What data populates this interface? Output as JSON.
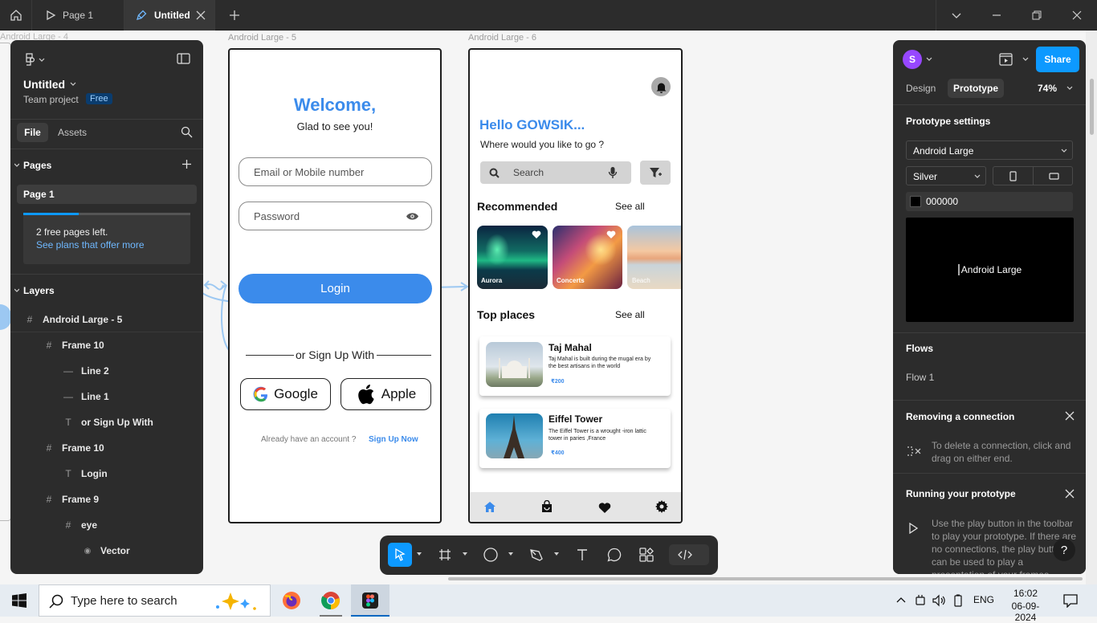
{
  "titlebar": {
    "tabs": [
      {
        "label": "Page 1"
      },
      {
        "label": "Untitled"
      }
    ]
  },
  "canvas": {
    "frame_labels": [
      "Android Large - 4",
      "Android Large - 5",
      "Android Large - 6"
    ]
  },
  "left_panel": {
    "file_name": "Untitled",
    "project": "Team project",
    "plan_badge": "Free",
    "tabs": {
      "file": "File",
      "assets": "Assets"
    },
    "pages_header": "Pages",
    "page_item": "Page 1",
    "free_pages_text": "2 free pages left.",
    "free_pages_fill": 0.33,
    "plans_link": "See plans that offer more",
    "layers_header": "Layers",
    "layers": [
      {
        "label": "Android Large - 5",
        "icon": "frame-icon"
      },
      {
        "label": "Frame 10",
        "icon": "frame-icon"
      },
      {
        "label": "Line 2",
        "icon": "line-icon"
      },
      {
        "label": "Line 1",
        "icon": "line-icon"
      },
      {
        "label": "or Sign Up With",
        "icon": "text-icon"
      },
      {
        "label": "Frame 10",
        "icon": "frame-icon"
      },
      {
        "label": "Login",
        "icon": "text-icon"
      },
      {
        "label": "Frame 9",
        "icon": "frame-icon"
      },
      {
        "label": "eye",
        "icon": "frame-icon"
      },
      {
        "label": "Vector",
        "icon": "vector-icon"
      }
    ]
  },
  "login_screen": {
    "welcome": "Welcome,",
    "subtitle": "Glad to see you!",
    "email_placeholder": "Email or Mobile number",
    "password_placeholder": "Password",
    "login_button": "Login",
    "divider_text": "or Sign Up With",
    "google": "Google",
    "apple": "Apple",
    "account_prompt": "Already have an account ?",
    "signup_link": "Sign Up Now"
  },
  "home_screen": {
    "greeting": "Hello GOWSIK...",
    "question": "Where would you like to go ?",
    "search_placeholder": "Search",
    "recommended": "Recommended",
    "see_all": "See all",
    "cards": [
      {
        "label": "Aurora"
      },
      {
        "label": "Concerts"
      },
      {
        "label": "Beach"
      }
    ],
    "top_places": "Top places",
    "places": [
      {
        "name": "Taj Mahal",
        "desc": "Taj Mahal  is built during the mugal era by the best artisans in the world",
        "price": "₹200"
      },
      {
        "name": "Eiffel Tower",
        "desc": "The Eiffel Tower is a wrought -iron lattic tower in paries ,France",
        "price": "₹400"
      }
    ]
  },
  "right_panel": {
    "avatar_letter": "S",
    "share": "Share",
    "tabs": {
      "design": "Design",
      "prototype": "Prototype"
    },
    "zoom": "74%",
    "settings_title": "Prototype settings",
    "device": "Android Large",
    "model": "Silver",
    "bg_color": "000000",
    "preview_alt": "Android Large",
    "flows_title": "Flows",
    "flow_item": "Flow 1",
    "removing_title": "Removing a connection",
    "removing_text": "To delete a connection, click and drag on either end.",
    "running_title": "Running your prototype",
    "running_text": "Use the play button in the toolbar to play your prototype. If there are no connections, the play button can be used to play a presentation of your frames."
  },
  "taskbar": {
    "search_placeholder": "Type here to search",
    "language": "ENG",
    "time": "16:02",
    "date": "06-09-2024"
  },
  "colors": {
    "accent": "#0d99ff",
    "brand_blue": "#3b8beb",
    "dark_ui": "#2c2c2c",
    "badge": "#0a5dbd",
    "avatar": "#9747ff"
  }
}
